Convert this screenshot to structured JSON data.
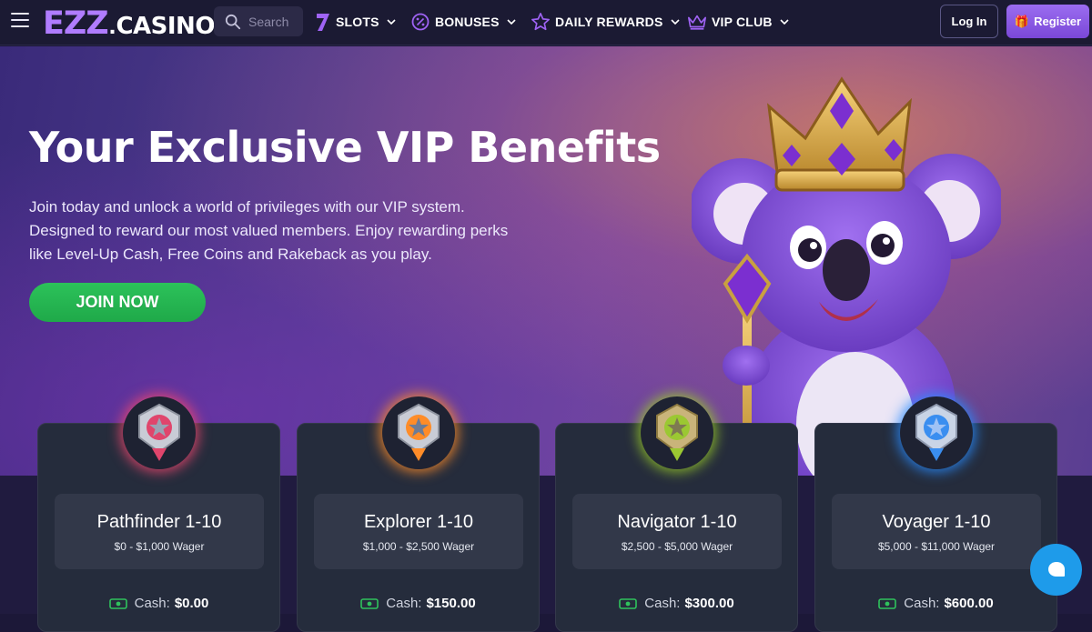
{
  "header": {
    "logo_main": "EZZ",
    "logo_sep": ".",
    "logo_sub": "CASINO",
    "search_placeholder": "Search",
    "nav": [
      {
        "label": "SLOTS",
        "icon": "seven-icon"
      },
      {
        "label": "BONUSES",
        "icon": "percent-badge-icon"
      },
      {
        "label": "DAILY REWARDS",
        "icon": "star-icon"
      },
      {
        "label": "VIP CLUB",
        "icon": "crown-icon"
      }
    ],
    "login_label": "Log In",
    "register_label": "Register",
    "register_icon": "gift-icon"
  },
  "hero": {
    "title": "Your Exclusive VIP Benefits",
    "description": "Join today and unlock a world of privileges with our VIP system. Designed to reward our most valued members. Enjoy rewarding perks like Level-Up Cash, Free Coins and Rakeback as you play.",
    "cta_label": "JOIN NOW",
    "mascot": "koala-king-mascot"
  },
  "tiers": [
    {
      "name": "Pathfinder 1-10",
      "range": "$0 - $1,000 Wager",
      "cash_label": "Cash:",
      "cash_value": "$0.00",
      "color": "#f0466e"
    },
    {
      "name": "Explorer 1-10",
      "range": "$1,000 - $2,500 Wager",
      "cash_label": "Cash:",
      "cash_value": "$150.00",
      "color": "#ff8c28"
    },
    {
      "name": "Navigator 1-10",
      "range": "$2,500 - $5,000 Wager",
      "cash_label": "Cash:",
      "cash_value": "$300.00",
      "color": "#96c828"
    },
    {
      "name": "Voyager 1-10",
      "range": "$5,000 - $11,000 Wager",
      "cash_label": "Cash:",
      "cash_value": "$600.00",
      "color": "#288cff"
    }
  ],
  "colors": {
    "accent_purple": "#b07cff",
    "join_green": "#22b04f",
    "chat_blue": "#1e9bea"
  },
  "chat_icon": "chat-bubble-icon"
}
